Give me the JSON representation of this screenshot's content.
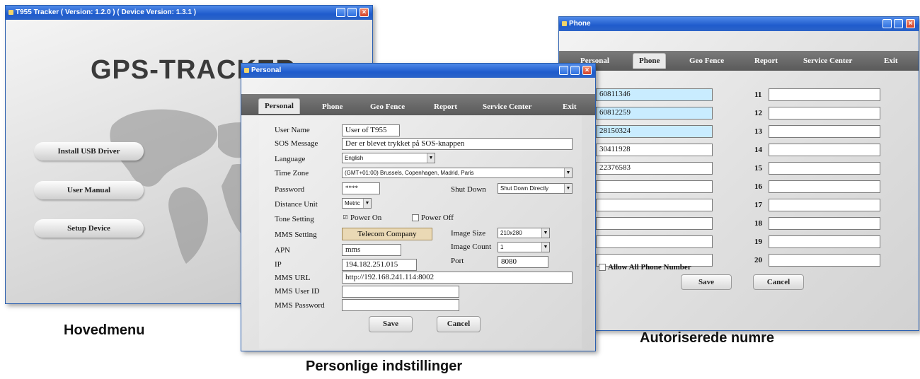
{
  "main_window": {
    "title": "T955 Tracker  ( Version: 1.2.0 )  ( Device Version: 1.3.1 )",
    "logo": "GPS-TRACKER",
    "buttons": [
      "Install USB Driver",
      "User Manual",
      "Setup Device"
    ]
  },
  "phone_window": {
    "title": "Phone",
    "tabs": [
      "Personal",
      "Phone",
      "Geo Fence",
      "Report",
      "Service Center",
      "Exit"
    ],
    "active_tab": "Phone",
    "numbers_left": [
      "60811346",
      "60812259",
      "28150324",
      "30411928",
      "22376583",
      "",
      "",
      "",
      "",
      ""
    ],
    "highlighted_rows": [
      1,
      2,
      3
    ],
    "row_labels_right": [
      "11",
      "12",
      "13",
      "14",
      "15",
      "16",
      "17",
      "18",
      "19",
      "20"
    ],
    "allow_all_label": "Allow All Phone Number",
    "save_label": "Save",
    "cancel_label": "Cancel"
  },
  "personal_window": {
    "title": "Personal",
    "tabs": [
      "Personal",
      "Phone",
      "Geo Fence",
      "Report",
      "Service Center",
      "Exit"
    ],
    "active_tab": "Personal",
    "labels": {
      "user_name": "User Name",
      "sos_message": "SOS Message",
      "language": "Language",
      "time_zone": "Time Zone",
      "password": "Password",
      "shut_down": "Shut Down",
      "distance_unit": "Distance Unit",
      "tone_setting": "Tone Setting",
      "mms_setting": "MMS Setting",
      "image_size": "Image Size",
      "apn": "APN",
      "image_count": "Image Count",
      "ip": "IP",
      "port": "Port",
      "mms_url": "MMS URL",
      "mms_user_id": "MMS User ID",
      "mms_password": "MMS Password"
    },
    "values": {
      "user_name": "User of  T955",
      "sos_message": "Der er blevet trykket på SOS-knappen",
      "language": "English",
      "time_zone": "(GMT+01:00) Brussels, Copenhagen, Madrid, Paris",
      "password": "****",
      "shut_down": "Shut Down Directly",
      "distance_unit": "Metric",
      "tone_power_on": "Power On",
      "tone_power_off": "Power Off",
      "tone_selected": "Power On",
      "mms_setting_button": "Telecom Company",
      "image_size": "210x280",
      "apn": "mms",
      "image_count": "1",
      "ip": "194.182.251.015",
      "port": "8080",
      "mms_url": "http://192.168.241.114:8002",
      "mms_user_id": "",
      "mms_password": ""
    },
    "save_label": "Save",
    "cancel_label": "Cancel"
  },
  "captions": {
    "main": "Hovedmenu",
    "personal": "Personlige indstillinger",
    "phone": "Autoriserede numre"
  },
  "colors": {
    "titlebar": "#1f5bcc",
    "highlight_field": "#c9ecff",
    "tab_bar": "#5a5a5a"
  }
}
